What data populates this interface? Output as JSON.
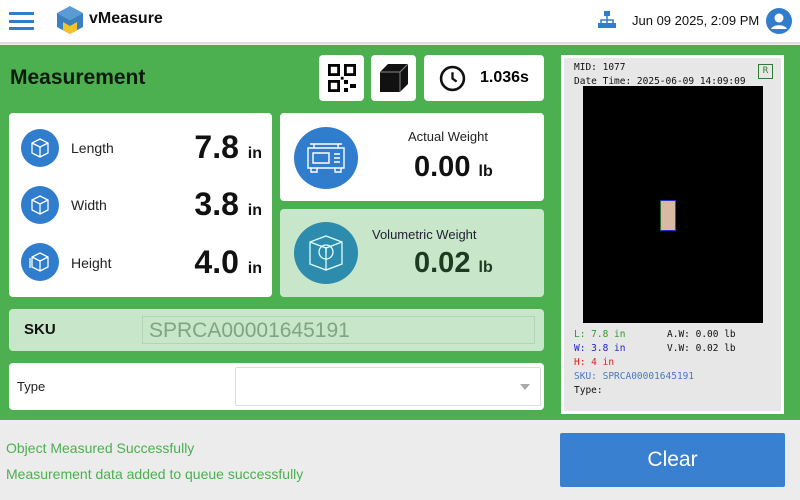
{
  "header": {
    "app_name": "vMeasure",
    "datetime": "Jun 09 2025, 2:09 PM"
  },
  "main": {
    "title": "Measurement",
    "elapsed": "1.036s",
    "dimensions": [
      {
        "label": "Length",
        "value": "7.8",
        "unit": "in"
      },
      {
        "label": "Width",
        "value": "3.8",
        "unit": "in"
      },
      {
        "label": "Height",
        "value": "4.0",
        "unit": "in"
      }
    ],
    "actual_weight": {
      "label": "Actual Weight",
      "value": "0.00",
      "unit": "lb"
    },
    "volumetric_weight": {
      "label": "Volumetric Weight",
      "value": "0.02",
      "unit": "lb"
    },
    "sku": {
      "label": "SKU",
      "value": "SPRCA00001645191"
    },
    "type": {
      "label": "Type",
      "value": ""
    }
  },
  "preview": {
    "mid": "MID: 1077",
    "datetime": "Date Time: 2025-06-09 14:09:09",
    "badge": "R",
    "l": "L: 7.8 in",
    "w": "W: 3.8 in",
    "h": "H: 4 in",
    "aw": "A.W: 0.00 lb",
    "vw": "V.W: 0.02 lb",
    "sku": "SKU: SPRCA00001645191",
    "type": "Type:"
  },
  "status": {
    "line1": "Object Measured Successfully",
    "line2": "Measurement data added to queue successfully"
  },
  "actions": {
    "clear": "Clear"
  },
  "colors": {
    "green": "#4caf50",
    "blue": "#2f7dcc",
    "light_green": "#c8e6c9"
  }
}
